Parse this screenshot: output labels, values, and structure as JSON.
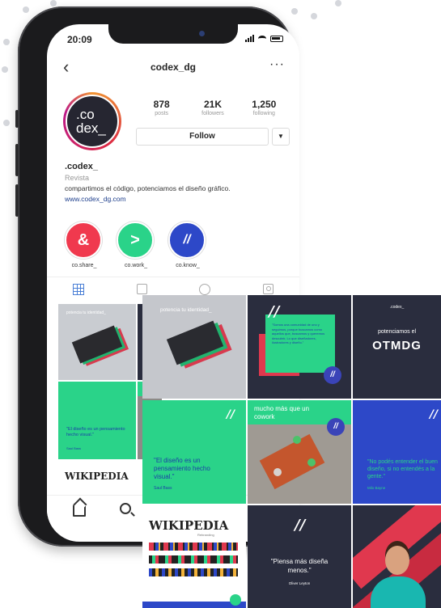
{
  "status_bar": {
    "time": "20:09"
  },
  "profile": {
    "username": "codex_dg",
    "avatar_text": [
      ".co",
      "dex_"
    ],
    "posts_count": "878",
    "posts_label": "posts",
    "followers_count": "21K",
    "followers_label": "followers",
    "following_count": "1,250",
    "following_label": "following",
    "follow_button": "Follow",
    "display_name": ".codex_",
    "category": "Revista",
    "bio": "compartimos el código, potenciamos el diseño gráfico.",
    "link": "www.codex_dg.com"
  },
  "highlights": [
    {
      "label": "co.share_",
      "glyph": "&",
      "color": "#f0394e"
    },
    {
      "label": "co.work_",
      "glyph": ">",
      "color": "#2ad389"
    },
    {
      "label": "co.know_",
      "glyph": "//",
      "color": "#2d48c8"
    }
  ],
  "phone_posts": [
    {
      "text": "potencia tu identidad_"
    },
    {
      "text": "\"El diseño es un pensamiento hecho visual.\""
    },
    {
      "text": "Saul Bass"
    },
    {
      "text": "WIKIPEDIA"
    }
  ],
  "posts": [
    {
      "text": "potencia tu identidad_"
    },
    {
      "text": "\"Somos una comunidad de uno y seguimos, porque buscamos como aquellos que, buscamos y queremos descubrir, Lo que diseñadores, ilustradores y diseño.\""
    },
    {
      "text": ".codex_"
    },
    {
      "text": "potenciamos el"
    },
    {
      "text": "OTMDG"
    },
    {
      "text": "\"El diseño es un pensamiento hecho visual.\""
    },
    {
      "text": "Saul Bass"
    },
    {
      "text": "mucho más que un cowork"
    },
    {
      "text": "\"No podés entender el buen diseño, si no entendés a la gente.\""
    },
    {
      "text": "Milo Bayne"
    },
    {
      "text": "WIKIPEDIA"
    },
    {
      "text": "Rebranding"
    },
    {
      "text": "\"Piensa más diseña menos.\""
    },
    {
      "text": "Oliver Leyton"
    }
  ]
}
